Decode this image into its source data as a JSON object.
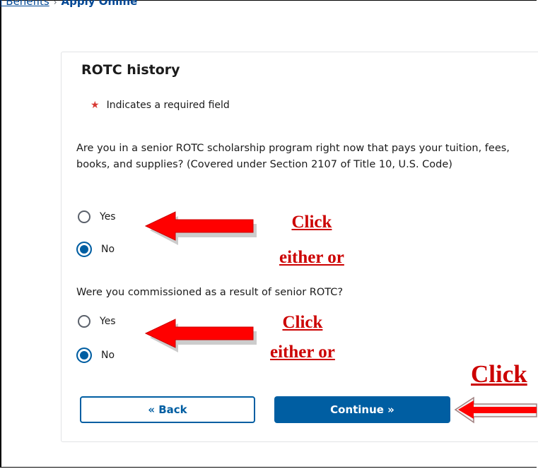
{
  "breadcrumb": {
    "partial_link": "n Benefits",
    "separator": "›",
    "current": "Apply Online"
  },
  "form": {
    "title": "ROTC history",
    "required_note": "Indicates a required field",
    "question1": {
      "text": "Are you in a senior ROTC scholarship program right now that pays your tuition, fees, books, and supplies? (Covered under Section 2107 of Title 10, U.S. Code)",
      "options": [
        {
          "label": "Yes",
          "selected": false
        },
        {
          "label": "No",
          "selected": true
        }
      ]
    },
    "question2": {
      "text": "Were you commissioned as a result of senior ROTC?",
      "options": [
        {
          "label": "Yes",
          "selected": false
        },
        {
          "label": "No",
          "selected": true
        }
      ]
    },
    "back_label": "« Back",
    "continue_label": "Continue »"
  },
  "annotations": {
    "note1_line1": "Click",
    "note1_line2": "either or",
    "note2_line1": "Click",
    "note2_line2": "either or",
    "note3": "Click"
  },
  "colors": {
    "primary": "#005ea2",
    "annotation": "#cc0000",
    "required_star": "#d83933"
  }
}
